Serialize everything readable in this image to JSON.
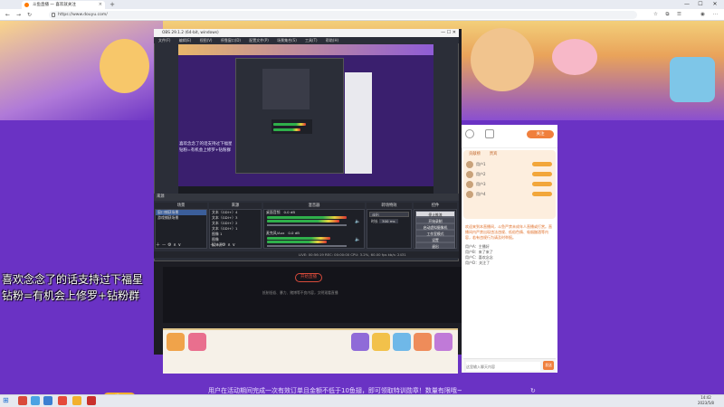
{
  "browser": {
    "tab_title": "斗鱼直播 一 喜欢就关注",
    "tab_close": "×",
    "new_tab": "+",
    "url": "https://www.douyu.com/",
    "win_min": "—",
    "win_max": "☐",
    "win_close": "✕",
    "nav_back": "←",
    "nav_forward": "→",
    "nav_reload": "↻"
  },
  "obs": {
    "title": "OBS 29.1.2 (64-bit, windows)",
    "menu": [
      "文件(F)",
      "编辑(E)",
      "视图(V)",
      "停靠窗口(D)",
      "配置文件(P)",
      "场景集合(S)",
      "工具(T)",
      "帮助(H)"
    ],
    "lower_title": "来源",
    "dock_headers": [
      "场景",
      "来源",
      "混音器",
      "转场特效",
      "控件"
    ],
    "scenes": [
      "窗口捕获场景",
      "游戏捕获场景"
    ],
    "sources": [
      "文本（GDI+）4",
      "文本（GDI+）3",
      "文本（GDI+）2",
      "文本（GDI+）1",
      "图像 1",
      "图像",
      "媒体源"
    ],
    "mixer": [
      {
        "name": "桌面音频",
        "level": "0.0 dB"
      },
      {
        "name": "麦克风/Aux",
        "level": "0.0 dB"
      }
    ],
    "transition_label": "淡出",
    "duration_label": "时长",
    "duration_value": "300 ms",
    "controls": [
      "停止推流",
      "开始录制",
      "启动虚拟摄像机",
      "工作室模式",
      "设置",
      "退出"
    ],
    "status": "LIVE: 00:56:19   REC: 00:00:00   CPU: 3.2%, 60.00 fps   kb/s: 2431"
  },
  "overlay": {
    "line1": "喜欢念念了的话支持过下福星",
    "line2": "钻粉=有机会上修罗+钻粉群"
  },
  "stage": {
    "center_button": "开始直播",
    "caption": "抵制低俗、暴力、赌博等不良内容，文明观看直播"
  },
  "side": {
    "follow_label": "关注",
    "tab_rank": "贡献榜",
    "tab_noble": "贵宾",
    "users": [
      "用户1",
      "用户2",
      "用户3",
      "用户4"
    ],
    "chat_notice": "欢迎来到本直播间，斗鱼严禁未成年人直播或打赏。直播间内严禁出现违法违规、低俗色情、吸烟酗酒等内容，若有违规行为请及时举报。",
    "chat_msgs": [
      "用户A：主播好",
      "用户B：来了来了",
      "用户C：喜欢念念",
      "用户D：关注了"
    ],
    "input_placeholder": "这里输入聊天内容",
    "send": "发送"
  },
  "notice": {
    "badge": "提示",
    "text": "用户在活动期间完成一次有效订单且金额不低于10鱼翅，即可领取特训勋章！数量有限哦~"
  },
  "taskbar": {
    "start": "⊞",
    "time": "14:42",
    "date": "2023/5/8"
  },
  "colors": {
    "page_purple": "#6a32c4",
    "douyu_orange": "#ff7a00",
    "obs_dark": "#2b2e38",
    "meter_green": "#2fb04b"
  }
}
